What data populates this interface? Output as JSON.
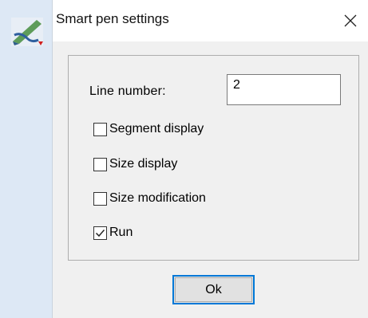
{
  "window": {
    "title": "Smart pen settings",
    "close_glyph": "✕",
    "icon": "smart-pen-icon"
  },
  "form": {
    "line_number_label": "Line number:",
    "line_number_value": "2"
  },
  "options": [
    {
      "label": "Segment display",
      "checked": false
    },
    {
      "label": "Size display",
      "checked": false
    },
    {
      "label": "Size modification",
      "checked": false
    },
    {
      "label": "Run",
      "checked": true
    }
  ],
  "buttons": {
    "ok_label": "Ok"
  },
  "colors": {
    "accent": "#0078d7",
    "dialog_bg": "#f0f0f0",
    "left_strip_bg": "#dde8f5"
  }
}
